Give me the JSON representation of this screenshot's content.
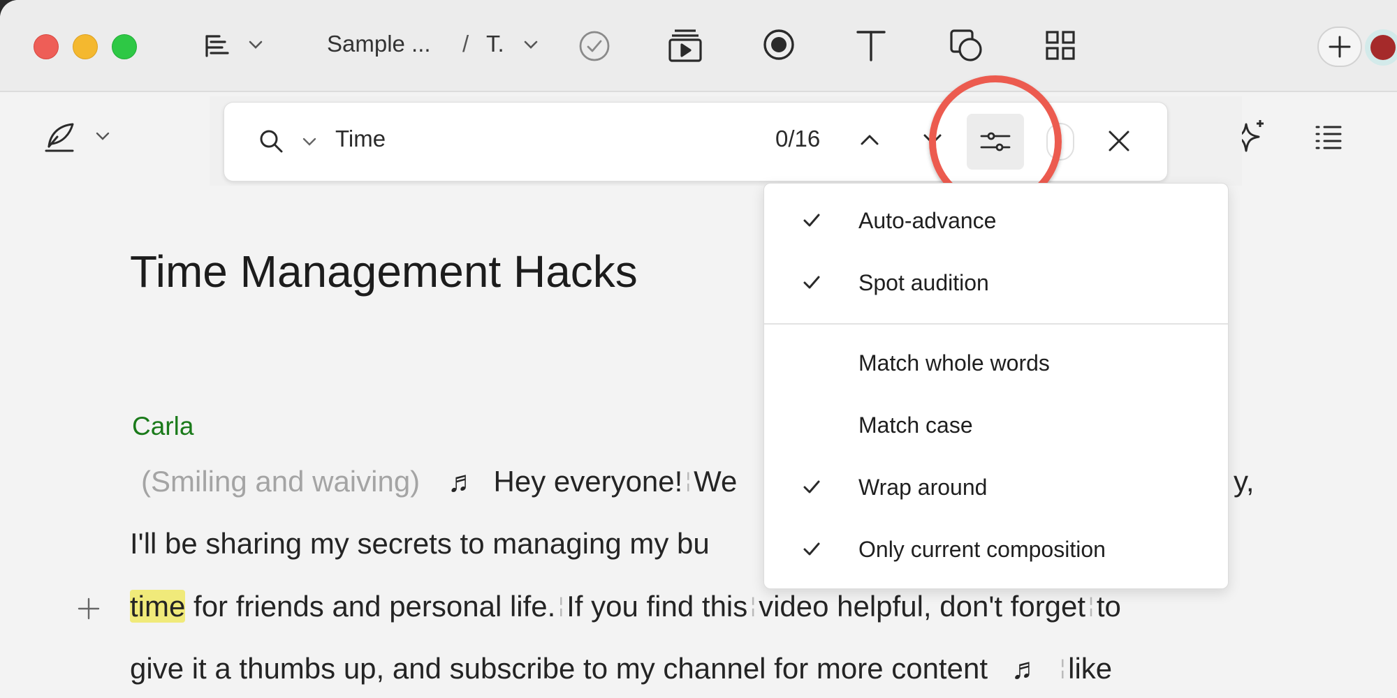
{
  "window": {
    "close_label": "close",
    "minimize_label": "minimize",
    "zoom_label": "zoom"
  },
  "titlebar": {
    "breadcrumb_project": "Sample ...",
    "breadcrumb_separator": "/",
    "breadcrumb_composition": "T.",
    "icons": [
      "script-view-icon",
      "chevron-down-icon",
      "checkmark-circle-icon",
      "play-scene-icon",
      "record-icon",
      "text-icon",
      "shapes-icon",
      "grid-icon",
      "add-icon",
      "avatar"
    ]
  },
  "find": {
    "query": "Time",
    "count": "0/16",
    "icons": [
      "search-icon",
      "chevron-down-icon",
      "previous-result-icon",
      "next-result-icon",
      "sliders-icon",
      "close-icon"
    ]
  },
  "menu": {
    "items": [
      {
        "label": "Auto-advance",
        "checked": true
      },
      {
        "label": "Spot audition",
        "checked": true
      },
      {
        "label": "Match whole words",
        "checked": false
      },
      {
        "label": "Match case",
        "checked": false
      },
      {
        "label": "Wrap around",
        "checked": true
      },
      {
        "label": "Only current composition",
        "checked": true
      }
    ]
  },
  "document": {
    "title": "Time Management Hacks",
    "speaker": "Carla",
    "line1": {
      "stage_direction": "(Smiling and waiving)",
      "text_a": "Hey everyone!",
      "text_b": "We",
      "tail": "y,"
    },
    "line2": {
      "text": "I'll be sharing my secrets to managing my bu"
    },
    "line3": {
      "highlight": "time",
      "text_a": "for friends and personal life.",
      "text_b": "If you find this",
      "text_c": "video helpful, don't forget",
      "text_d": "to"
    },
    "line4": {
      "text_a": "give it a thumbs up, and subscribe to my channel for more content",
      "text_b": "like"
    }
  },
  "colors": {
    "accent_ring": "#ec5b4f",
    "speaker": "#1a7a1a",
    "highlight": "#f0ea7a",
    "stage_direction": "#a4a4a4"
  }
}
